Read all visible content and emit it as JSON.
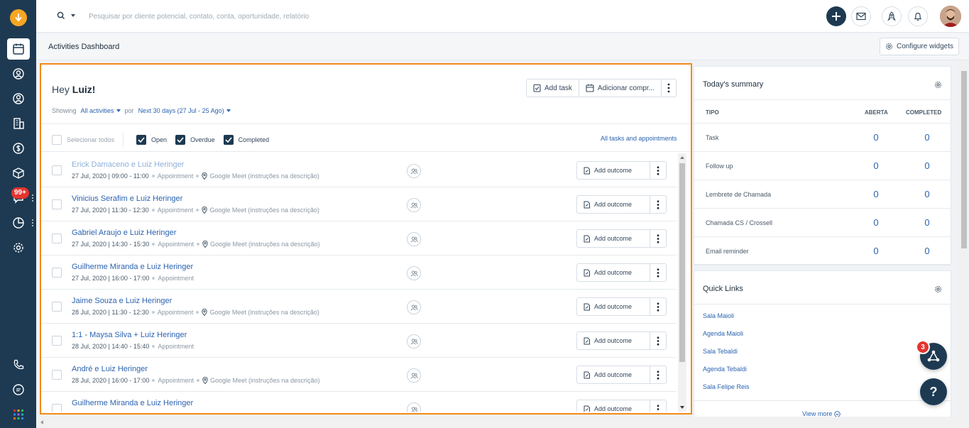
{
  "colors": {
    "rail": "#1e3a52",
    "accent": "#2b63b0",
    "highlight": "#f28a1a",
    "badge": "#e4342f",
    "logo": "#f5a623"
  },
  "nav": {
    "items": [
      "calendar-icon",
      "contact-icon",
      "user-icon",
      "building-icon",
      "dollar-icon",
      "box-icon",
      "chat-icon",
      "pie-chart-icon",
      "gear-icon"
    ],
    "bottom": [
      "phone-icon",
      "message-icon",
      "apps-grid-icon"
    ],
    "chat_badge": "99+"
  },
  "search": {
    "placeholder": "Pesquisar por cliente potencial, contato, conta, oportunidade, relatório"
  },
  "page": {
    "title": "Activities Dashboard",
    "configure_label": "Configure widgets"
  },
  "activities": {
    "greeting_prefix": "Hey ",
    "greeting_name": "Luiz!",
    "add_task_label": "Add task",
    "add_appointment_label": "Adicionar compr...",
    "showing_label": "Showing",
    "filter_label": "All activities",
    "por_label": "por",
    "range_label": "Next 30 days (27 Jul - 25 Ago)",
    "select_all_label": "Selecionar todos",
    "status_filters": [
      {
        "label": "Open",
        "checked": true
      },
      {
        "label": "Overdue",
        "checked": true
      },
      {
        "label": "Completed",
        "checked": true
      }
    ],
    "all_link": "All tasks and appointments",
    "outcome_label": "Add outcome",
    "rows": [
      {
        "name": "Erick Damaceno e Luiz Heringer",
        "time": "27 Jul, 2020 | 09:00 - 11:00",
        "type": "Appointment",
        "location": "Google Meet (instruções na descrição)"
      },
      {
        "name": "Vinicius Serafim e Luiz Heringer",
        "time": "27 Jul, 2020 | 11:30 - 12:30",
        "type": "Appointment",
        "location": "Google Meet (instruções na descrição)"
      },
      {
        "name": "Gabriel Araujo e Luiz Heringer",
        "time": "27 Jul, 2020 | 14:30 - 15:30",
        "type": "Appointment",
        "location": "Google Meet (instruções na descrição)"
      },
      {
        "name": "Guilherme Miranda e Luiz Heringer",
        "time": "27 Jul, 2020 | 16:00 - 17:00",
        "type": "Appointment",
        "location": ""
      },
      {
        "name": "Jaime Souza e Luiz Heringer",
        "time": "28 Jul, 2020 | 11:30 - 12:30",
        "type": "Appointment",
        "location": "Google Meet (instruções na descrição)"
      },
      {
        "name": "1:1 - Maysa Silva + Luiz Heringer",
        "time": "28 Jul, 2020 | 14:40 - 15:40",
        "type": "Appointment",
        "location": ""
      },
      {
        "name": "André e Luiz Heringer",
        "time": "28 Jul, 2020 | 16:00 - 17:00",
        "type": "Appointment",
        "location": "Google Meet (instruções na descrição)"
      },
      {
        "name": "Guilherme Miranda e Luiz Heringer",
        "time": "",
        "type": "",
        "location": ""
      }
    ]
  },
  "summary": {
    "title": "Today's summary",
    "columns": [
      "TIPO",
      "ABERTA",
      "COMPLETED"
    ],
    "rows": [
      {
        "tipo": "Task",
        "aberta": "0",
        "completed": "0"
      },
      {
        "tipo": "Follow up",
        "aberta": "0",
        "completed": "0"
      },
      {
        "tipo": "Lembrete de Chamada",
        "aberta": "0",
        "completed": "0"
      },
      {
        "tipo": "Chamada CS / Crossell",
        "aberta": "0",
        "completed": "0"
      },
      {
        "tipo": "Email reminder",
        "aberta": "0",
        "completed": "0"
      }
    ]
  },
  "quick_links": {
    "title": "Quick Links",
    "links": [
      "Sala Maioli",
      "Agenda Maioli",
      "Sala Tebaldi",
      "Agenda Tebaldi",
      "Sala Felipe Reis"
    ],
    "view_more": "View more"
  },
  "fab": {
    "badge": "3",
    "help": "?"
  }
}
